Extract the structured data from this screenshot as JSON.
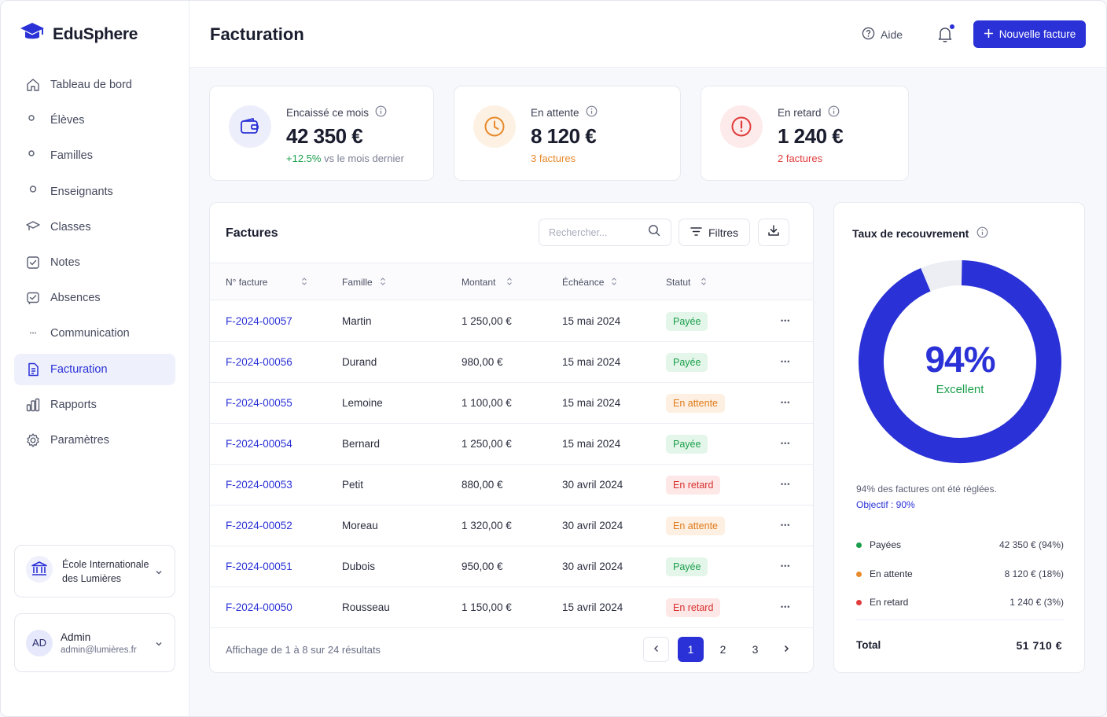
{
  "brand": {
    "name": "EduSphere"
  },
  "sidebar": {
    "items": [
      {
        "label": "Tableau de bord",
        "icon": "home-icon"
      },
      {
        "label": "Élèves",
        "icon": "students-icon"
      },
      {
        "label": "Familles",
        "icon": "families-icon"
      },
      {
        "label": "Enseignants",
        "icon": "teacher-icon"
      },
      {
        "label": "Classes",
        "icon": "classes-icon"
      },
      {
        "label": "Notes",
        "icon": "notes-icon"
      },
      {
        "label": "Absences",
        "icon": "absences-icon"
      },
      {
        "label": "Communication",
        "icon": "chat-icon"
      },
      {
        "label": "Facturation",
        "icon": "invoice-icon",
        "active": true
      },
      {
        "label": "Rapports",
        "icon": "reports-icon"
      },
      {
        "label": "Paramètres",
        "icon": "settings-icon"
      }
    ],
    "school": {
      "name": "École Internationale des Lumières"
    },
    "user": {
      "initials": "AD",
      "name": "Admin",
      "email": "admin@lumières.fr"
    }
  },
  "header": {
    "title": "Facturation",
    "help_label": "Aide",
    "new_invoice_label": "Nouvelle facture"
  },
  "stats": [
    {
      "label": "Encaissé ce mois",
      "value": "42 350 €",
      "sub_highlight": "+12.5%",
      "sub_rest": " vs le mois dernier",
      "color": "#2a31d6"
    },
    {
      "label": "En attente",
      "value": "8 120 €",
      "sub_highlight": "3 factures",
      "sub_rest": "",
      "color": "#e8892b"
    },
    {
      "label": "En retard",
      "value": "1 240 €",
      "sub_highlight": "2 factures",
      "sub_rest": "",
      "color": "#e03c3c"
    }
  ],
  "invoices": {
    "title": "Factures",
    "search_placeholder": "Rechercher...",
    "filters_label": "Filtres",
    "columns": [
      "N° facture",
      "Famille",
      "Montant",
      "Échéance",
      "Statut"
    ],
    "rows": [
      {
        "num": "F-2024-00057",
        "family": "Martin",
        "amount": "1 250,00 €",
        "due": "15 mai 2024",
        "status": "Payée",
        "kind": "paid"
      },
      {
        "num": "F-2024-00056",
        "family": "Durand",
        "amount": "980,00 €",
        "due": "15 mai 2024",
        "status": "Payée",
        "kind": "paid"
      },
      {
        "num": "F-2024-00055",
        "family": "Lemoine",
        "amount": "1 100,00 €",
        "due": "15 mai 2024",
        "status": "En attente",
        "kind": "pending"
      },
      {
        "num": "F-2024-00054",
        "family": "Bernard",
        "amount": "1 250,00 €",
        "due": "15 mai 2024",
        "status": "Payée",
        "kind": "paid"
      },
      {
        "num": "F-2024-00053",
        "family": "Petit",
        "amount": "880,00 €",
        "due": "30 avril 2024",
        "status": "En retard",
        "kind": "late"
      },
      {
        "num": "F-2024-00052",
        "family": "Moreau",
        "amount": "1 320,00 €",
        "due": "30 avril 2024",
        "status": "En attente",
        "kind": "pending"
      },
      {
        "num": "F-2024-00051",
        "family": "Dubois",
        "amount": "950,00 €",
        "due": "30 avril 2024",
        "status": "Payée",
        "kind": "paid"
      },
      {
        "num": "F-2024-00050",
        "family": "Rousseau",
        "amount": "1 150,00 €",
        "due": "15 avril 2024",
        "status": "En retard",
        "kind": "late"
      }
    ],
    "footer": "Affichage de 1 à 8 sur 24 résultats",
    "pages": [
      "1",
      "2",
      "3"
    ],
    "current_page": "1"
  },
  "recovery": {
    "title": "Taux de recouvrement",
    "percent": 94,
    "percent_label": "94%",
    "rating": "Excellent",
    "note": "94% des factures ont été réglées.",
    "goal": "Objectif : 90%",
    "legend": [
      {
        "label": "Payées",
        "value": "42 350 € (94%)",
        "color": "#1a9e4b"
      },
      {
        "label": "En attente",
        "value": "8 120 € (18%)",
        "color": "#e8892b"
      },
      {
        "label": "En retard",
        "value": "1 240 € (3%)",
        "color": "#e03c3c"
      }
    ],
    "total_label": "Total",
    "total_value": "51 710 €"
  }
}
